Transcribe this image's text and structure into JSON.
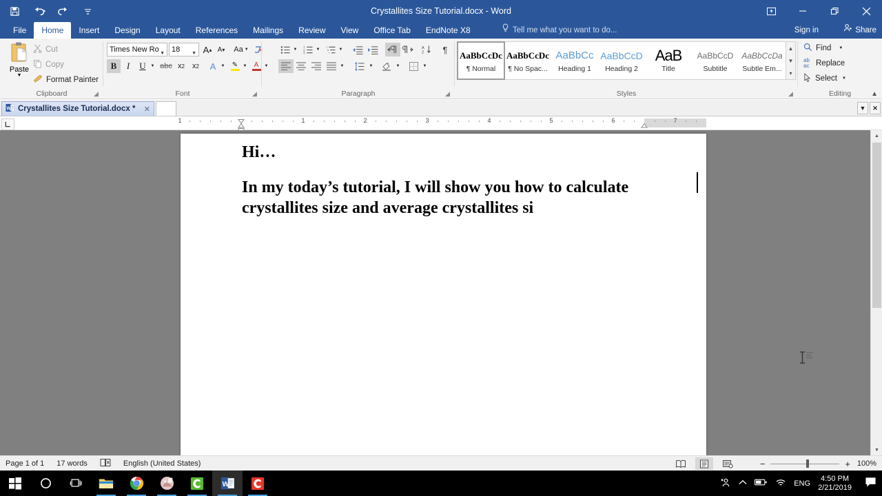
{
  "window": {
    "title": "Crystallites Size Tutorial.docx - Word",
    "quick_access": [
      "save-icon",
      "undo-icon",
      "redo-icon",
      "customize-qat-icon"
    ],
    "ribbon_display_icon": "ribbon-display-options-icon",
    "minimize": "minimize-icon",
    "restore": "restore-icon",
    "close": "close-icon"
  },
  "ribbon": {
    "tabs": [
      {
        "label": "File",
        "active": false
      },
      {
        "label": "Home",
        "active": true
      },
      {
        "label": "Insert",
        "active": false
      },
      {
        "label": "Design",
        "active": false
      },
      {
        "label": "Layout",
        "active": false
      },
      {
        "label": "References",
        "active": false
      },
      {
        "label": "Mailings",
        "active": false
      },
      {
        "label": "Review",
        "active": false
      },
      {
        "label": "View",
        "active": false
      },
      {
        "label": "Office Tab",
        "active": false
      },
      {
        "label": "EndNote X8",
        "active": false
      }
    ],
    "tellme": "Tell me what you want to do...",
    "signin": "Sign in",
    "share": "Share",
    "groups": {
      "clipboard": {
        "label": "Clipboard",
        "paste": "Paste",
        "cut": "Cut",
        "copy": "Copy",
        "format_painter": "Format Painter"
      },
      "font": {
        "label": "Font",
        "font_name": "Times New Ro",
        "font_size": "18",
        "buttons": [
          "grow-font-icon",
          "shrink-font-icon",
          "change-case-icon",
          "clear-formatting-icon",
          "bold-icon",
          "italic-icon",
          "underline-icon",
          "strikethrough-icon",
          "subscript-icon",
          "superscript-icon",
          "text-effects-icon",
          "text-highlight-icon",
          "font-color-icon"
        ],
        "bold_active": true
      },
      "paragraph": {
        "label": "Paragraph",
        "buttons": [
          "bullets-icon",
          "numbering-icon",
          "multilevel-list-icon",
          "decrease-indent-icon",
          "increase-indent-icon",
          "ltr-text-direction-icon",
          "rtl-text-direction-icon",
          "sort-icon",
          "show-formatting-marks-icon",
          "align-left-icon",
          "align-center-icon",
          "align-right-icon",
          "justify-icon",
          "line-spacing-icon",
          "shading-icon",
          "borders-icon"
        ],
        "align_left_active": true,
        "ltr_active": true
      },
      "styles": {
        "label": "Styles",
        "items": [
          {
            "sample": "AaBbCcDc",
            "name": "¶ Normal",
            "selected": true
          },
          {
            "sample": "AaBbCcDc",
            "name": "¶ No Spac...",
            "selected": false
          },
          {
            "sample": "AaBbCc",
            "name": "Heading 1",
            "selected": false
          },
          {
            "sample": "AaBbCcD",
            "name": "Heading 2",
            "selected": false
          },
          {
            "sample": "AaB",
            "name": "Title",
            "selected": false
          },
          {
            "sample": "AaBbCcD",
            "name": "Subtitle",
            "selected": false
          },
          {
            "sample": "AaBbCcDa",
            "name": "Subtle Em...",
            "selected": false
          }
        ]
      },
      "editing": {
        "label": "Editing",
        "find": "Find",
        "replace": "Replace",
        "select": "Select"
      }
    }
  },
  "office_tab": {
    "doc_tab_label": "Crystallites Size Tutorial.docx *",
    "doc_tab_icon": "word-doc-icon",
    "close_tab_icon": "close-tab-icon",
    "dropdown_icon": "tab-list-dropdown-icon",
    "close_bar_icon": "close-tab-bar-icon"
  },
  "ruler": {
    "corner_label": "tab-stop-left-icon",
    "horizontal_numbers": [
      "1",
      "1",
      "2",
      "3",
      "4",
      "5",
      "6",
      "7"
    ],
    "left_indent_marker": "first-line-indent-marker",
    "right_indent_marker": "right-indent-marker"
  },
  "document": {
    "paragraphs": [
      "Hi…",
      "In my today’s tutorial, I will show you how to calculate crystallites size and average crystallites si"
    ],
    "font": "Times New Roman",
    "size": "18",
    "cursor_icon": "text-ibeam-cursor"
  },
  "status_bar": {
    "page": "Page 1 of 1",
    "words": "17 words",
    "proofing_icon": "proofing-errors-icon",
    "language": "English (United States)",
    "views": [
      {
        "icon": "read-mode-icon",
        "active": false
      },
      {
        "icon": "print-layout-icon",
        "active": true
      },
      {
        "icon": "web-layout-icon",
        "active": false
      }
    ],
    "zoom_out": "−",
    "zoom_in": "+",
    "zoom_level": "100%"
  },
  "taskbar": {
    "items": [
      {
        "icon": "windows-start-icon",
        "active": false,
        "running": false
      },
      {
        "icon": "cortana-search-icon",
        "active": false,
        "running": false
      },
      {
        "icon": "task-view-icon",
        "active": false,
        "running": false
      },
      {
        "icon": "file-explorer-icon",
        "active": false,
        "running": true
      },
      {
        "icon": "google-chrome-icon",
        "active": false,
        "running": true
      },
      {
        "icon": "photo-viewer-icon",
        "active": false,
        "running": true
      },
      {
        "icon": "camtasia-studio-icon",
        "active": false,
        "running": true
      },
      {
        "icon": "microsoft-word-icon",
        "active": true,
        "running": true
      },
      {
        "icon": "camtasia-recorder-icon",
        "active": false,
        "running": true
      }
    ],
    "tray": {
      "people_icon": "people-icon",
      "show_hidden_icon": "show-hidden-icons-icon",
      "battery_icon": "battery-icon",
      "network_icon": "wifi-icon",
      "language": "ENG",
      "time": "4:50 PM",
      "date": "2/21/2019",
      "action_center_icon": "action-center-icon"
    }
  },
  "colors": {
    "word_blue": "#2b579a",
    "ribbon_bg": "#f3f3f3",
    "doc_bg": "#808080",
    "accent_underline": "#4aa3e0"
  }
}
